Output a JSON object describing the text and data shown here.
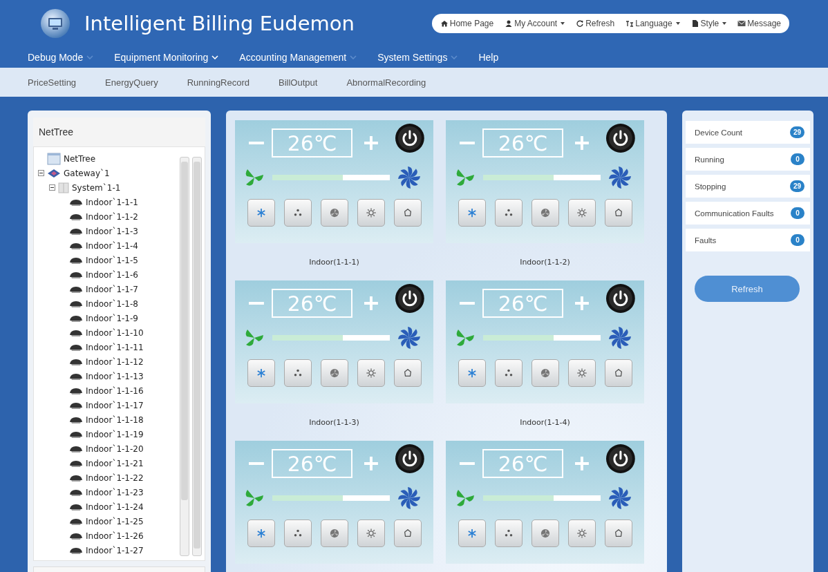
{
  "app": {
    "title": "Intelligent Billing Eudemon"
  },
  "toolbar": [
    {
      "label": "Home Page",
      "kind": "home",
      "dropdown": false
    },
    {
      "label": "My Account",
      "kind": "account",
      "dropdown": true
    },
    {
      "label": "Refresh",
      "kind": "refresh",
      "dropdown": false
    },
    {
      "label": "Language",
      "kind": "language",
      "dropdown": true
    },
    {
      "label": "Style",
      "kind": "style",
      "dropdown": true
    },
    {
      "label": "Message",
      "kind": "message",
      "dropdown": false
    }
  ],
  "menu": [
    {
      "label": "Debug Mode",
      "dropdown": true
    },
    {
      "label": "Equipment Monitoring",
      "dropdown": true
    },
    {
      "label": "Accounting Management",
      "dropdown": true
    },
    {
      "label": "System Settings",
      "dropdown": true
    },
    {
      "label": "Help",
      "dropdown": false
    }
  ],
  "submenu": [
    "PriceSetting",
    "EnergyQuery",
    "RunningRecord",
    "BillOutput",
    "AbnormalRecording"
  ],
  "tree": {
    "title": "NetTree",
    "items": [
      {
        "label": "NetTree",
        "kind": "root"
      },
      {
        "label": "Gateway`1",
        "kind": "gateway",
        "expanded": true,
        "children": [
          {
            "label": "System`1-1",
            "kind": "system",
            "expanded": true,
            "children": [
              {
                "label": "Indoor`1-1-1",
                "kind": "indoor"
              },
              {
                "label": "Indoor`1-1-2",
                "kind": "indoor"
              },
              {
                "label": "Indoor`1-1-3",
                "kind": "indoor"
              },
              {
                "label": "Indoor`1-1-4",
                "kind": "indoor"
              },
              {
                "label": "Indoor`1-1-5",
                "kind": "indoor"
              },
              {
                "label": "Indoor`1-1-6",
                "kind": "indoor"
              },
              {
                "label": "Indoor`1-1-7",
                "kind": "indoor"
              },
              {
                "label": "Indoor`1-1-8",
                "kind": "indoor"
              },
              {
                "label": "Indoor`1-1-9",
                "kind": "indoor"
              },
              {
                "label": "Indoor`1-1-10",
                "kind": "indoor"
              },
              {
                "label": "Indoor`1-1-11",
                "kind": "indoor"
              },
              {
                "label": "Indoor`1-1-12",
                "kind": "indoor"
              },
              {
                "label": "Indoor`1-1-13",
                "kind": "indoor"
              },
              {
                "label": "Indoor`1-1-16",
                "kind": "indoor"
              },
              {
                "label": "Indoor`1-1-17",
                "kind": "indoor"
              },
              {
                "label": "Indoor`1-1-18",
                "kind": "indoor"
              },
              {
                "label": "Indoor`1-1-19",
                "kind": "indoor"
              },
              {
                "label": "Indoor`1-1-20",
                "kind": "indoor"
              },
              {
                "label": "Indoor`1-1-21",
                "kind": "indoor"
              },
              {
                "label": "Indoor`1-1-22",
                "kind": "indoor"
              },
              {
                "label": "Indoor`1-1-23",
                "kind": "indoor"
              },
              {
                "label": "Indoor`1-1-24",
                "kind": "indoor"
              },
              {
                "label": "Indoor`1-1-25",
                "kind": "indoor"
              },
              {
                "label": "Indoor`1-1-26",
                "kind": "indoor"
              },
              {
                "label": "Indoor`1-1-27",
                "kind": "indoor"
              }
            ]
          }
        ]
      }
    ]
  },
  "units": [
    {
      "temperature": "26℃",
      "level": 0.6,
      "label": "Indoor(1-1-1)"
    },
    {
      "temperature": "26℃",
      "level": 0.6,
      "label": "Indoor(1-1-2)"
    },
    {
      "temperature": "26℃",
      "level": 0.6,
      "label": "Indoor(1-1-3)"
    },
    {
      "temperature": "26℃",
      "level": 0.6,
      "label": "Indoor(1-1-4)"
    },
    {
      "temperature": "26℃",
      "level": 0.6
    },
    {
      "temperature": "26℃",
      "level": 0.6
    }
  ],
  "stats": [
    {
      "label": "Device Count",
      "count": "29"
    },
    {
      "label": "Running",
      "count": "0"
    },
    {
      "label": "Stopping",
      "count": "29"
    },
    {
      "label": "Communication Faults",
      "count": "0"
    },
    {
      "label": "Faults",
      "count": "0"
    }
  ],
  "refresh_button": "Refresh"
}
